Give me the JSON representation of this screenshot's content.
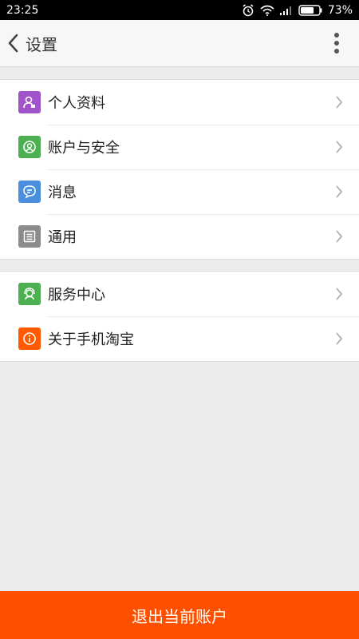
{
  "status_bar": {
    "time": "23:25",
    "battery": "73%",
    "battery_level": 0.73
  },
  "header": {
    "title": "设置",
    "back_icon": "chevron-left-icon",
    "more_icon": "more-vertical-icon"
  },
  "groups": [
    {
      "items": [
        {
          "label": "个人资料",
          "icon": "profile-icon",
          "color": "#a154c9"
        },
        {
          "label": "账户与安全",
          "icon": "account-security-icon",
          "color": "#4caf50"
        },
        {
          "label": "消息",
          "icon": "message-icon",
          "color": "#4a8fdb"
        },
        {
          "label": "通用",
          "icon": "general-icon",
          "color": "#8c8c8c"
        }
      ]
    },
    {
      "items": [
        {
          "label": "服务中心",
          "icon": "service-center-icon",
          "color": "#4caf50"
        },
        {
          "label": "关于手机淘宝",
          "icon": "info-icon",
          "color": "#ff5a00"
        }
      ]
    }
  ],
  "logout": {
    "label": "退出当前账户",
    "color": "#ff5000"
  }
}
